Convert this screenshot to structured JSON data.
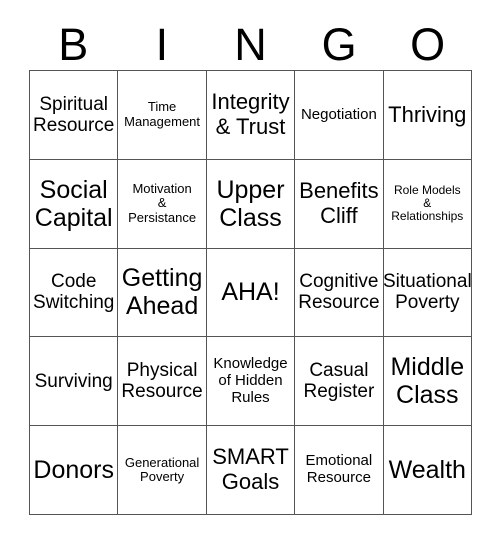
{
  "card": {
    "type": "bingo-card",
    "title_letters": [
      "B",
      "I",
      "N",
      "G",
      "O"
    ],
    "columns": 5,
    "rows": 5,
    "border_color": "#555555",
    "text_color": "#000000",
    "background_color": "#ffffff",
    "cells": [
      [
        {
          "text": "Spiritual\nResource",
          "size": "md"
        },
        {
          "text": "Time\nManagement",
          "size": "xs"
        },
        {
          "text": "Integrity\n& Trust",
          "size": "lg"
        },
        {
          "text": "Negotiation",
          "size": "sm"
        },
        {
          "text": "Thriving",
          "size": "lg"
        }
      ],
      [
        {
          "text": "Social\nCapital",
          "size": "xl"
        },
        {
          "text": "Motivation\n&\nPersistance",
          "size": "xs"
        },
        {
          "text": "Upper\nClass",
          "size": "xl"
        },
        {
          "text": "Benefits\nCliff",
          "size": "lg"
        },
        {
          "text": "Role Models\n&\nRelationships",
          "size": "xxs"
        }
      ],
      [
        {
          "text": "Code\nSwitching",
          "size": "md"
        },
        {
          "text": "Getting\nAhead",
          "size": "xl"
        },
        {
          "text": "AHA!",
          "size": "xl"
        },
        {
          "text": "Cognitive\nResource",
          "size": "md"
        },
        {
          "text": "Situational\nPoverty",
          "size": "md"
        }
      ],
      [
        {
          "text": "Surviving",
          "size": "md"
        },
        {
          "text": "Physical\nResource",
          "size": "md"
        },
        {
          "text": "Knowledge\nof Hidden\nRules",
          "size": "sm"
        },
        {
          "text": "Casual\nRegister",
          "size": "md"
        },
        {
          "text": "Middle\nClass",
          "size": "xl"
        }
      ],
      [
        {
          "text": "Donors",
          "size": "xl"
        },
        {
          "text": "Generational\nPoverty",
          "size": "xs"
        },
        {
          "text": "SMART\nGoals",
          "size": "lg"
        },
        {
          "text": "Emotional\nResource",
          "size": "sm"
        },
        {
          "text": "Wealth",
          "size": "xl"
        }
      ]
    ]
  }
}
